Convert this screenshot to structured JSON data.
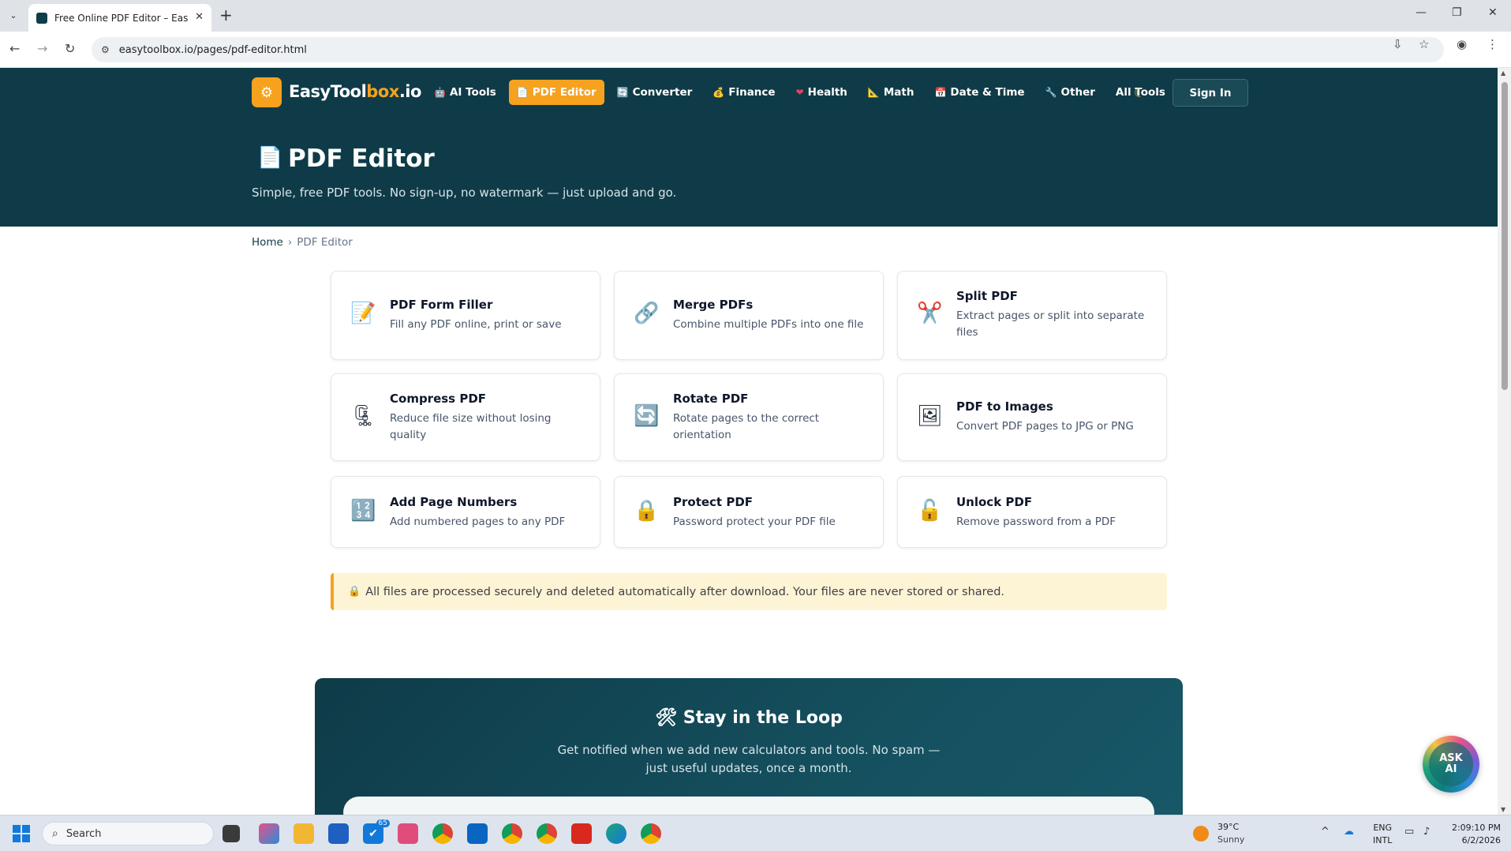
{
  "browser": {
    "tab_title": "Free Online PDF Editor – EasyTo",
    "new_tab_glyph": "+",
    "url": "easytoolbox.io/pages/pdf-editor.html"
  },
  "header": {
    "logo_text_main": "EasyTool",
    "logo_text_accent": "box",
    "logo_text_tail": ".io",
    "nav": [
      {
        "icon": "🤖",
        "label": "AI Tools",
        "active": false
      },
      {
        "icon": "📄",
        "label": "PDF Editor",
        "active": true
      },
      {
        "icon": "🔄",
        "label": "Converter",
        "active": false
      },
      {
        "icon": "💰",
        "label": "Finance",
        "active": false
      },
      {
        "icon": "❤",
        "label": "Health",
        "active": false
      },
      {
        "icon": "📐",
        "label": "Math",
        "active": false
      },
      {
        "icon": "📅",
        "label": "Date & Time",
        "active": false
      },
      {
        "icon": "🔧",
        "label": "Other",
        "active": false
      },
      {
        "icon": "",
        "label": "All Tools",
        "active": false
      }
    ],
    "signin_label": "Sign In"
  },
  "hero": {
    "title": "PDF Editor",
    "subtitle": "Simple, free PDF tools. No sign-up, no watermark — just upload and go."
  },
  "breadcrumb": {
    "home": "Home",
    "separator": "›",
    "current": "PDF Editor"
  },
  "tools": [
    {
      "icon": "📝",
      "title": "PDF Form Filler",
      "desc": "Fill any PDF online, print or save"
    },
    {
      "icon": "🔗",
      "title": "Merge PDFs",
      "desc": "Combine multiple PDFs into one file"
    },
    {
      "icon": "✂️",
      "title": "Split PDF",
      "desc": "Extract pages or split into separate files"
    },
    {
      "icon": "🗜",
      "title": "Compress PDF",
      "desc": "Reduce file size without losing quality"
    },
    {
      "icon": "🔄",
      "title": "Rotate PDF",
      "desc": "Rotate pages to the correct orientation"
    },
    {
      "icon": "🖼",
      "title": "PDF to Images",
      "desc": "Convert PDF pages to JPG or PNG"
    },
    {
      "icon": "🔢",
      "title": "Add Page Numbers",
      "desc": "Add numbered pages to any PDF"
    },
    {
      "icon": "🔒",
      "title": "Protect PDF",
      "desc": "Password protect your PDF file"
    },
    {
      "icon": "🔓",
      "title": "Unlock PDF",
      "desc": "Remove password from a PDF"
    }
  ],
  "notice": "All files are processed securely and deleted automatically after download. Your files are never stored or shared.",
  "newsletter": {
    "icon": "🛠",
    "title": "Stay in the Loop",
    "subtitle": "Get notified when we add new calculators and tools. No spam — just useful updates, once a month."
  },
  "ask_ai": {
    "line1": "ASK",
    "line2": "AI"
  },
  "taskbar": {
    "search_placeholder": "Search",
    "mail_badge": "65",
    "weather_temp": "39°C",
    "weather_desc": "Sunny",
    "lang_line1": "ENG",
    "lang_line2": "INTL",
    "time": "2:09:10 PM",
    "date": "6/2/2026"
  }
}
